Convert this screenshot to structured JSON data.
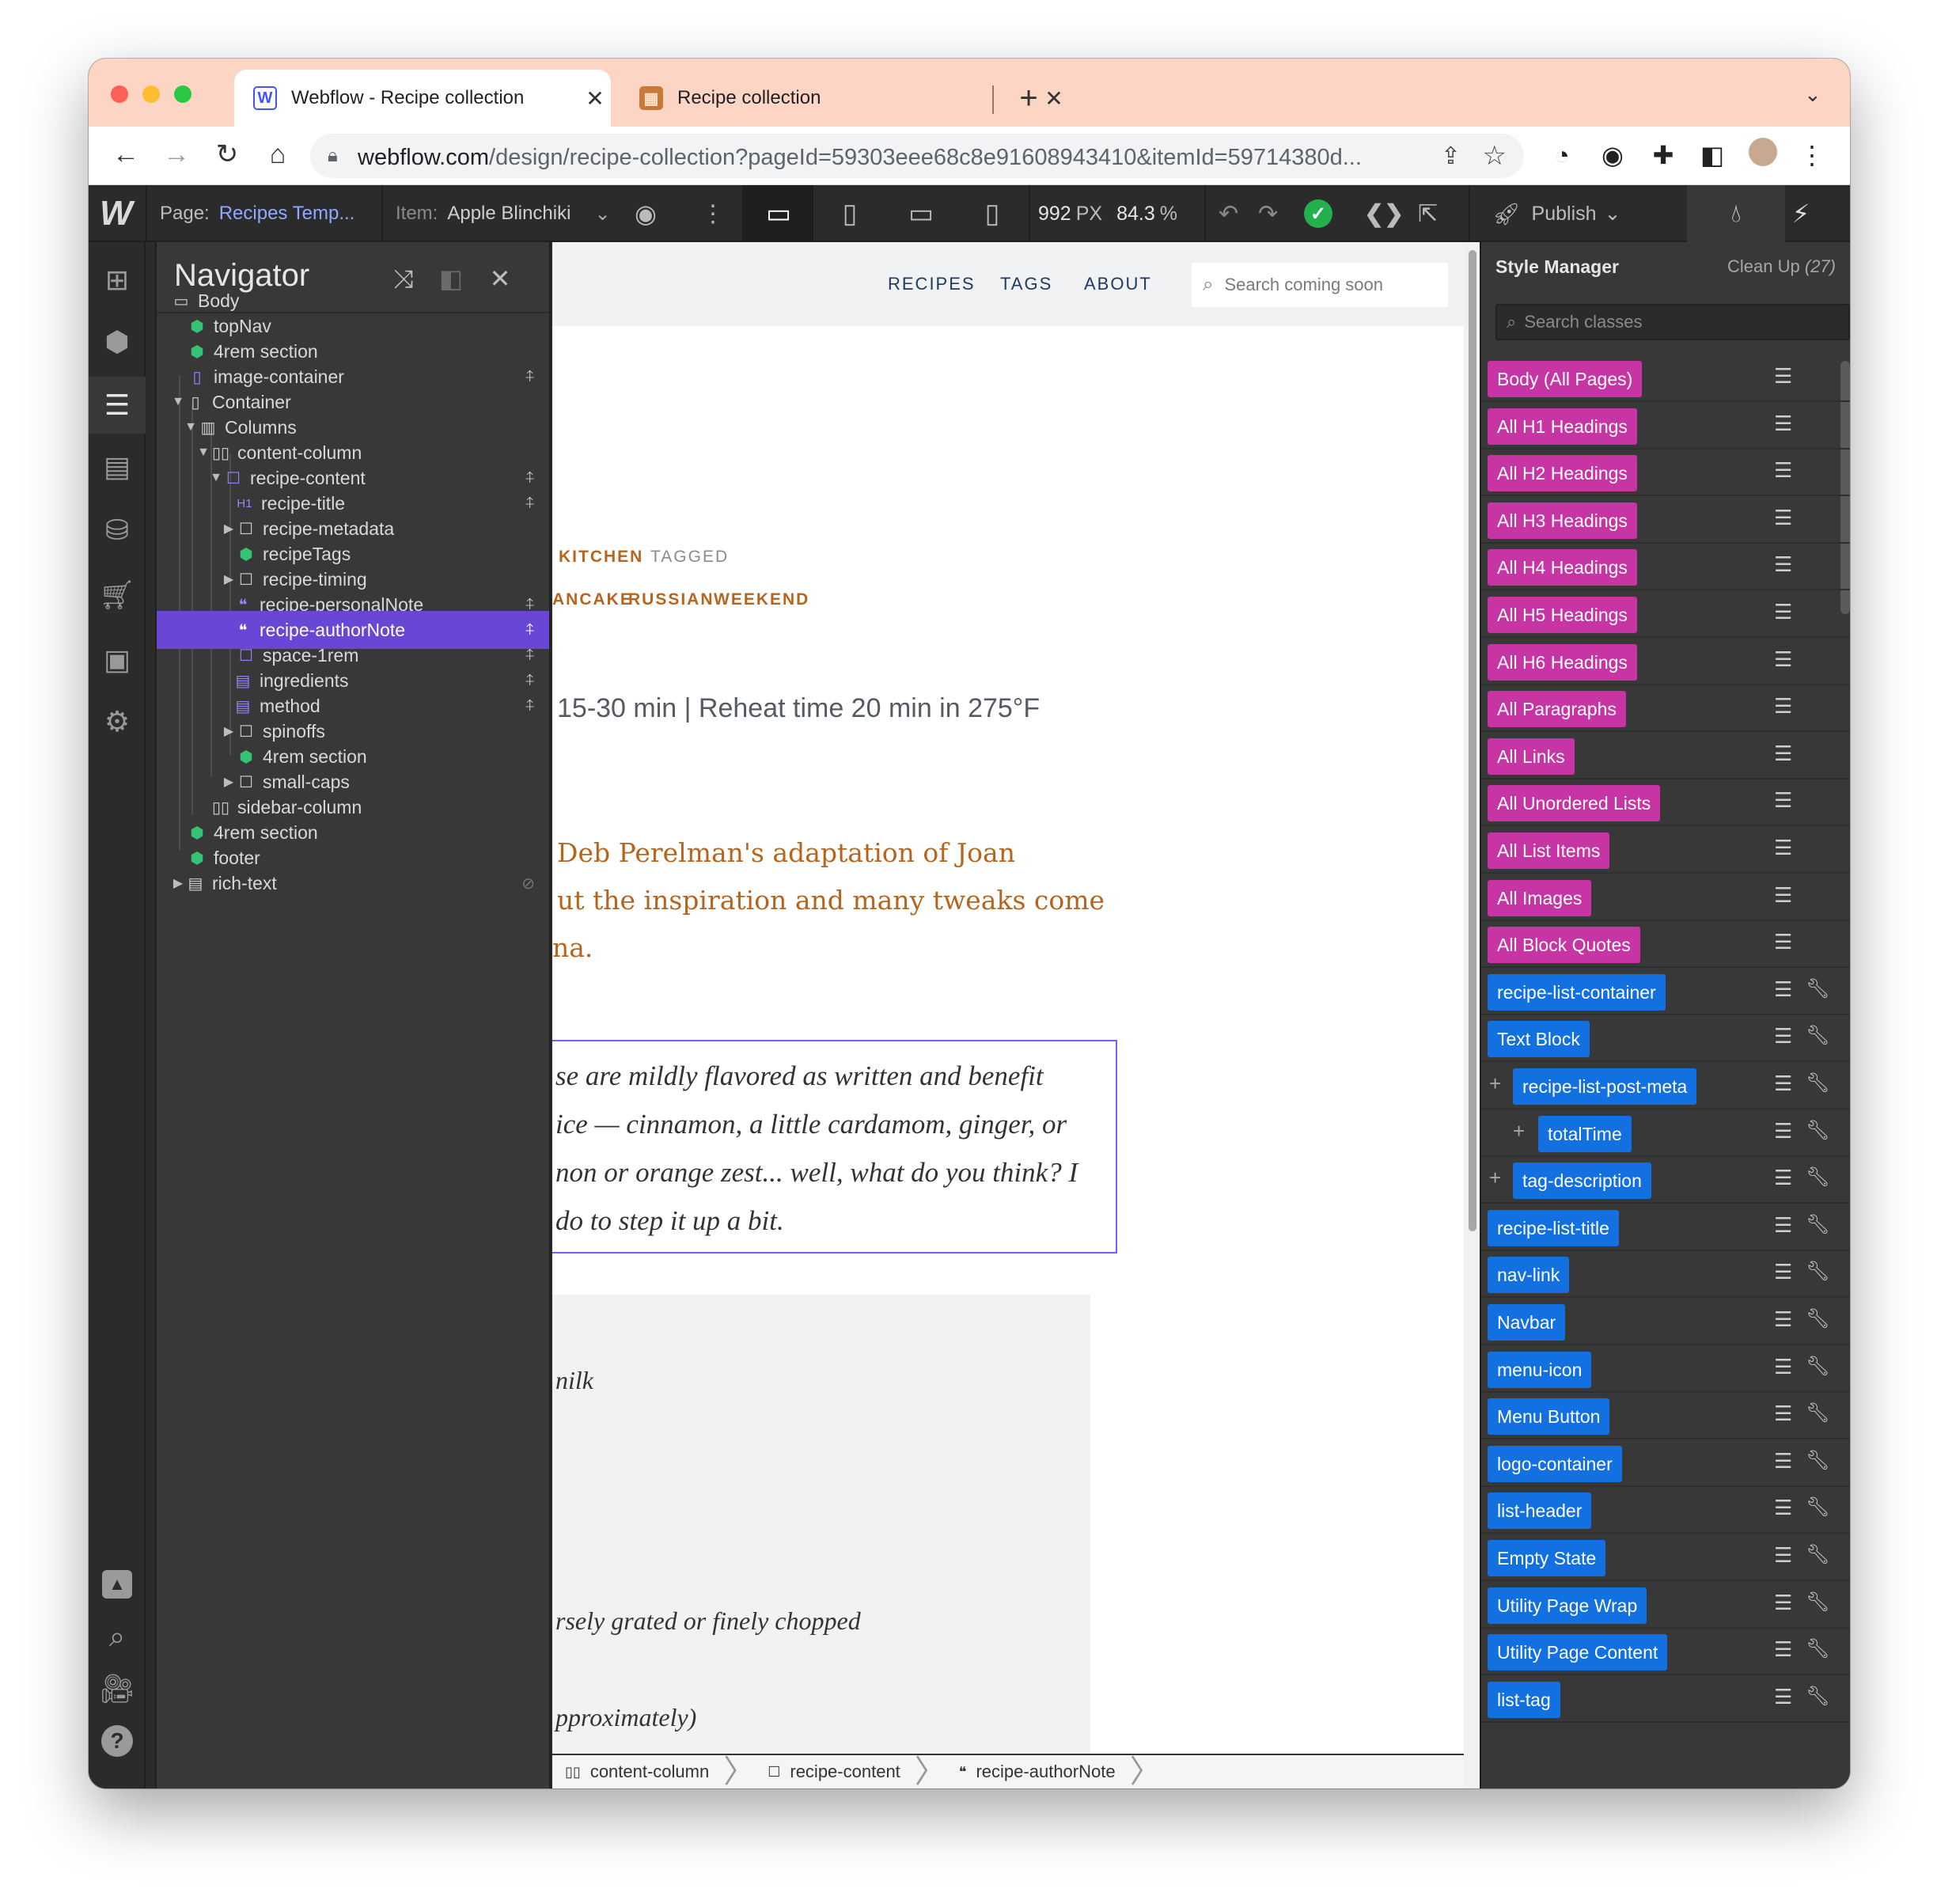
{
  "browser": {
    "tabs": [
      {
        "title": "Webflow - Recipe collection",
        "favicon": "webflow-favicon",
        "active": true
      },
      {
        "title": "Recipe collection",
        "favicon": "recipe-favicon",
        "active": false
      }
    ],
    "url_host": "webflow.com",
    "url_path": "/design/recipe-collection?pageId=59303eee68c8e91608943410&itemId=59714380d..."
  },
  "webflow_bar": {
    "page_label": "Page:",
    "page_value": "Recipes Temp...",
    "item_label": "Item:",
    "item_value": "Apple Blinchiki",
    "width_value": "992",
    "width_unit": "PX",
    "zoom_value": "84.3",
    "zoom_unit": "%",
    "publish_label": "Publish"
  },
  "navigator": {
    "title": "Navigator",
    "items": [
      {
        "label": "Body",
        "icon": "body-icon"
      },
      {
        "label": "topNav",
        "icon": "symbol-icon"
      },
      {
        "label": "4rem section",
        "icon": "symbol-icon"
      },
      {
        "label": "image-container",
        "icon": "div-block-icon"
      },
      {
        "label": "Container",
        "icon": "container-icon"
      },
      {
        "label": "Columns",
        "icon": "columns-icon"
      },
      {
        "label": "content-column",
        "icon": "column-icon"
      },
      {
        "label": "recipe-content",
        "icon": "div-block-icon"
      },
      {
        "label": "recipe-title",
        "icon": "heading-icon",
        "icon_text": "H1"
      },
      {
        "label": "recipe-metadata",
        "icon": "div-block-icon"
      },
      {
        "label": "recipeTags",
        "icon": "symbol-icon"
      },
      {
        "label": "recipe-timing",
        "icon": "div-block-icon"
      },
      {
        "label": "recipe-personalNote",
        "icon": "blockquote-icon"
      },
      {
        "label": "recipe-authorNote",
        "icon": "blockquote-icon"
      },
      {
        "label": "space-1rem",
        "icon": "div-block-icon"
      },
      {
        "label": "ingredients",
        "icon": "rich-text-icon"
      },
      {
        "label": "method",
        "icon": "rich-text-icon"
      },
      {
        "label": "spinoffs",
        "icon": "div-block-icon"
      },
      {
        "label": "4rem section",
        "icon": "symbol-icon"
      },
      {
        "label": "small-caps",
        "icon": "div-block-icon"
      },
      {
        "label": "sidebar-column",
        "icon": "column-icon"
      },
      {
        "label": "4rem section",
        "icon": "symbol-icon"
      },
      {
        "label": "footer",
        "icon": "symbol-icon"
      },
      {
        "label": "rich-text",
        "icon": "rich-text-icon"
      }
    ]
  },
  "canvas": {
    "nav_links": [
      "RECIPES",
      "TAGS",
      "ABOUT"
    ],
    "search_placeholder": "Search coming soon",
    "kitchen": "KITCHEN",
    "tagged": "TAGGED",
    "tags": [
      "ANCAKE",
      "RUSSIAN",
      "WEEKEND"
    ],
    "timing": "15-30 min | Reheat time 20 min in 275°F",
    "personal_note": [
      "Deb Perelman's adaptation of Joan",
      "ut the inspiration and many tweaks come",
      "na."
    ],
    "author_note": [
      "se are mildly flavored as written and benefit",
      "ice — cinnamon, a little cardamom, ginger, or",
      "non or orange zest... well, what do you think? I",
      "do to step it up a bit."
    ],
    "ingredients": [
      "nilk",
      "rsely grated or finely chopped",
      "pproximately)"
    ],
    "breadcrumb": [
      "content-column",
      "recipe-content",
      "recipe-authorNote"
    ]
  },
  "style_manager": {
    "title": "Style Manager",
    "cleanup_label": "Clean Up",
    "cleanup_count": "(27)",
    "search_placeholder": "Search classes",
    "classes": [
      {
        "name": "Body (All Pages)",
        "kind": "tag"
      },
      {
        "name": "All H1 Headings",
        "kind": "tag"
      },
      {
        "name": "All H2 Headings",
        "kind": "tag"
      },
      {
        "name": "All H3 Headings",
        "kind": "tag"
      },
      {
        "name": "All H4 Headings",
        "kind": "tag"
      },
      {
        "name": "All H5 Headings",
        "kind": "tag"
      },
      {
        "name": "All H6 Headings",
        "kind": "tag"
      },
      {
        "name": "All Paragraphs",
        "kind": "tag"
      },
      {
        "name": "All Links",
        "kind": "tag"
      },
      {
        "name": "All Unordered Lists",
        "kind": "tag"
      },
      {
        "name": "All List Items",
        "kind": "tag"
      },
      {
        "name": "All Images",
        "kind": "tag"
      },
      {
        "name": "All Block Quotes",
        "kind": "tag"
      },
      {
        "name": "recipe-list-container",
        "kind": "class"
      },
      {
        "name": "Text Block",
        "kind": "class"
      },
      {
        "name": "recipe-list-post-meta",
        "kind": "class"
      },
      {
        "name": "totalTime",
        "kind": "class"
      },
      {
        "name": "tag-description",
        "kind": "class"
      },
      {
        "name": "recipe-list-title",
        "kind": "class"
      },
      {
        "name": "nav-link",
        "kind": "class"
      },
      {
        "name": "Navbar",
        "kind": "class"
      },
      {
        "name": "menu-icon",
        "kind": "class"
      },
      {
        "name": "Menu Button",
        "kind": "class"
      },
      {
        "name": "logo-container",
        "kind": "class"
      },
      {
        "name": "list-header",
        "kind": "class"
      },
      {
        "name": "Empty State",
        "kind": "class"
      },
      {
        "name": "Utility Page Wrap",
        "kind": "class"
      },
      {
        "name": "Utility Page Content",
        "kind": "class"
      },
      {
        "name": "list-tag",
        "kind": "class"
      }
    ]
  },
  "colors": {
    "tabstrip": "#fcd5c5",
    "selection": "#6a46d6",
    "tag_pill": "#c735a4",
    "class_pill": "#1270e0",
    "publish_ok": "#22b14c",
    "recipe_orange": "#b5651d"
  }
}
